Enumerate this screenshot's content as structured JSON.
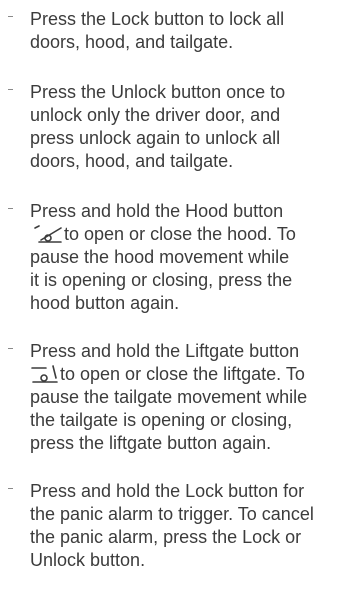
{
  "instructions": [
    {
      "lines": [
        "Press the Lock button to lock all",
        "doors, hood, and tailgate."
      ]
    },
    {
      "lines": [
        "Press the Unlock button once to",
        "unlock only the driver door, and",
        "press unlock again to unlock all",
        "doors, hood, and tailgate."
      ]
    },
    {
      "lines": [
        "Press and hold the Hood button",
        "to open or close the hood. To",
        "pause the hood movement while",
        "it is opening or closing, press the",
        "hood button again."
      ],
      "icon": "hood-icon"
    },
    {
      "lines": [
        "Press and hold the Liftgate button",
        "to open or close the liftgate. To",
        "pause the tailgate movement while",
        "the tailgate is opening or closing,",
        "press the liftgate button again."
      ],
      "icon": "liftgate-icon"
    },
    {
      "lines": [
        "Press and hold the Lock button for",
        "the panic alarm to trigger. To cancel",
        "the panic alarm, press the Lock or",
        "Unlock button."
      ]
    }
  ]
}
